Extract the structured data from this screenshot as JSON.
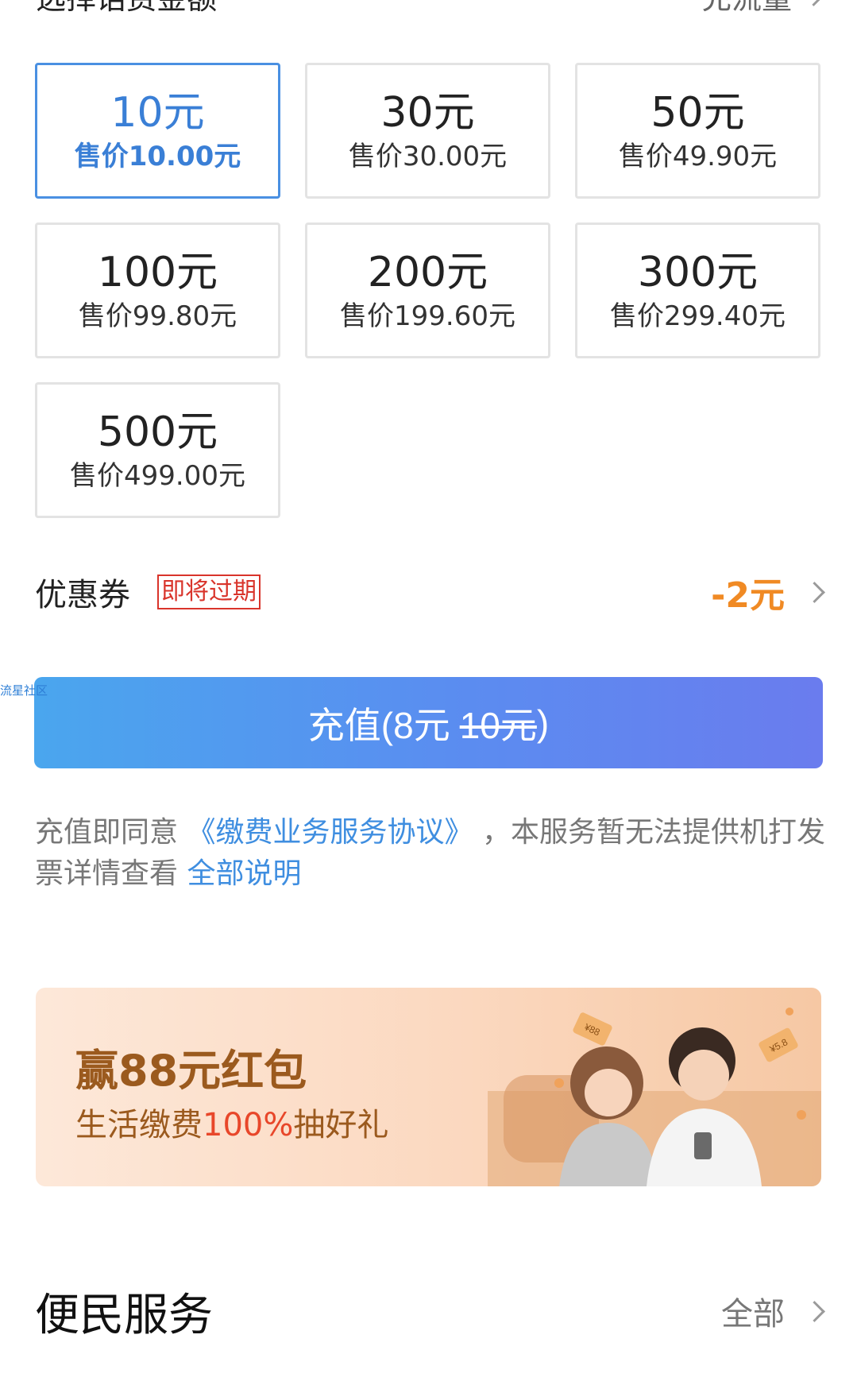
{
  "header": {
    "title": "选择话费金额",
    "right_label": "充流量"
  },
  "amounts": [
    {
      "face": "10元",
      "price": "售价10.00元",
      "selected": true
    },
    {
      "face": "30元",
      "price": "售价30.00元",
      "selected": false
    },
    {
      "face": "50元",
      "price": "售价49.90元",
      "selected": false
    },
    {
      "face": "100元",
      "price": "售价99.80元",
      "selected": false
    },
    {
      "face": "200元",
      "price": "售价199.60元",
      "selected": false
    },
    {
      "face": "300元",
      "price": "售价299.40元",
      "selected": false
    },
    {
      "face": "500元",
      "price": "售价499.00元",
      "selected": false
    }
  ],
  "coupon": {
    "label": "优惠券",
    "tag": "即将过期",
    "discount": "-2元"
  },
  "watermark": "流星社区",
  "recharge": {
    "prefix": "充值(8元",
    "original": "10元",
    "suffix": ")"
  },
  "agreement": {
    "prefix": "充值即同意",
    "link": "《缴费业务服务协议》",
    "middle": "，本服务暂无法提供机打发票详情查看",
    "detail_link": "全部说明"
  },
  "promo": {
    "title": "赢88元红包",
    "subtitle_prefix": "生活缴费",
    "subtitle_highlight": "100%",
    "subtitle_suffix": "抽好礼",
    "ticket1": "¥88",
    "ticket2": "¥5.8"
  },
  "service": {
    "heading": "便民服务",
    "all_label": "全部"
  },
  "colors": {
    "accent": "#3a7fd6",
    "discount": "#f08a24",
    "tag": "#d9342b",
    "promo_text": "#9b5a1e"
  }
}
